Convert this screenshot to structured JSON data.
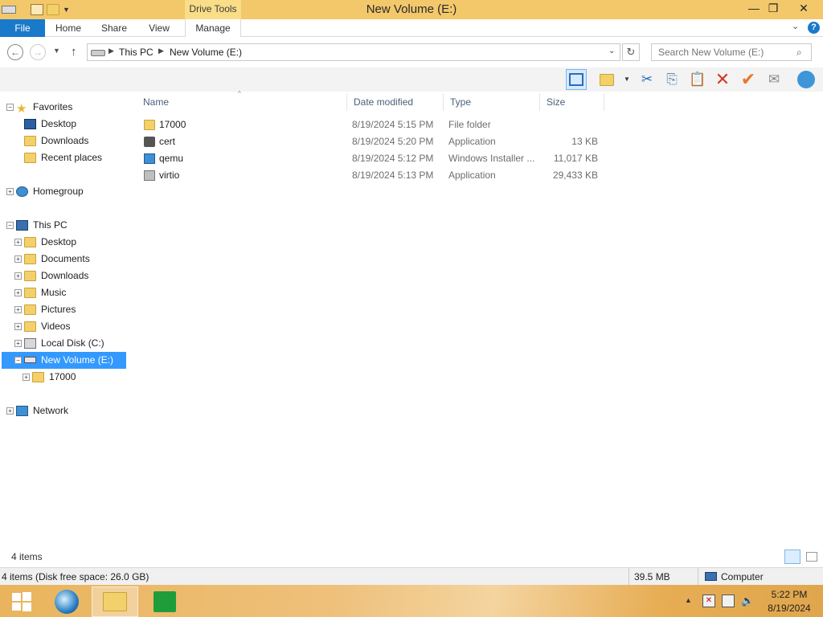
{
  "window": {
    "title": "New Volume (E:)",
    "context_tab": "Drive Tools",
    "minimize": "—",
    "maximize": "❐",
    "close": "✕"
  },
  "ribbon": {
    "tabs": [
      {
        "label": "File"
      },
      {
        "label": "Home"
      },
      {
        "label": "Share"
      },
      {
        "label": "View"
      },
      {
        "label": "Manage"
      }
    ],
    "help": "?"
  },
  "address": {
    "crumbs": [
      "This PC",
      "New Volume (E:)"
    ]
  },
  "search": {
    "placeholder": "Search New Volume (E:)"
  },
  "sidebar": {
    "favorites": {
      "label": "Favorites",
      "items": [
        "Desktop",
        "Downloads",
        "Recent places"
      ]
    },
    "homegroup": "Homegroup",
    "this_pc": {
      "label": "This PC",
      "items": [
        "Desktop",
        "Documents",
        "Downloads",
        "Music",
        "Pictures",
        "Videos",
        "Local Disk (C:)",
        "New Volume (E:)"
      ],
      "selected": "New Volume (E:)",
      "subfolder": "17000"
    },
    "network": "Network"
  },
  "columns": [
    "Name",
    "Date modified",
    "Type",
    "Size"
  ],
  "files": [
    {
      "name": "17000",
      "date": "8/19/2024 5:15 PM",
      "type": "File folder",
      "size": "",
      "icon": "folder-icon"
    },
    {
      "name": "cert",
      "date": "8/19/2024 5:20 PM",
      "type": "Application",
      "size": "13 KB",
      "icon": "app-icon"
    },
    {
      "name": "qemu",
      "date": "8/19/2024 5:12 PM",
      "type": "Windows Installer ...",
      "size": "11,017 KB",
      "icon": "installer-icon"
    },
    {
      "name": "virtio",
      "date": "8/19/2024 5:13 PM",
      "type": "Application",
      "size": "29,433 KB",
      "icon": "app-icon"
    }
  ],
  "status": {
    "items_count": "4 items",
    "disk_info": "4 items (Disk free space: 26.0 GB)",
    "size": "39.5 MB",
    "location": "Computer"
  },
  "clock": {
    "time": "5:22 PM",
    "date": "8/19/2024"
  },
  "colors": {
    "accent": "#1979ca",
    "title_bar": "#f2c86b",
    "selection": "#3399ff"
  }
}
